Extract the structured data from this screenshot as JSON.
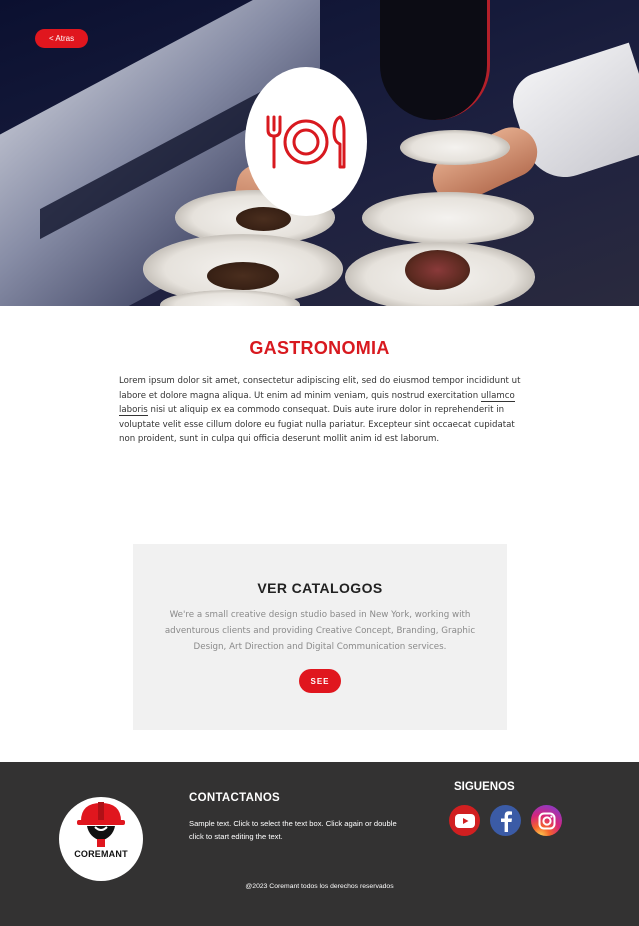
{
  "hero": {
    "back_label": "< Atras",
    "logo_icon": "plate-fork-knife-icon",
    "accent_color": "#e0161e"
  },
  "intro": {
    "title": "GASTRONOMIA",
    "text_before": "Lorem ipsum dolor sit amet, consectetur adipiscing elit, sed do eiusmod tempor incididunt ut labore et dolore magna aliqua. Ut enim ad minim veniam, quis nostrud exercitation ",
    "link_text": "ullamco laboris",
    "text_after": " nisi ut aliquip ex ea commodo consequat. Duis aute irure dolor in reprehenderit in voluptate velit esse cillum dolore eu fugiat nulla pariatur. Excepteur sint occaecat cupidatat non proident, sunt in culpa qui officia deserunt mollit anim id est laborum."
  },
  "catalog": {
    "title": "VER CATALOGOS",
    "text": "We're a small creative design studio based in New York, working with adventurous clients and providing Creative Concept, Branding, Graphic Design, Art Direction and Digital Communication services.",
    "button_label": "SEE"
  },
  "footer": {
    "brand_name": "COREMANT",
    "contact_title": "CONTACTANOS",
    "contact_text": "Sample text. Click to select the text box. Click again or double click to start editing the text.",
    "follow_title": "SIGUENOS",
    "social": [
      {
        "name": "youtube",
        "icon": "youtube-icon",
        "color": "#d11f20"
      },
      {
        "name": "facebook",
        "icon": "facebook-icon",
        "color": "#3b5ba6"
      },
      {
        "name": "instagram",
        "icon": "instagram-icon",
        "color": "#c13584"
      }
    ],
    "copyright": "@2023 Coremant todos los derechos reservados"
  }
}
